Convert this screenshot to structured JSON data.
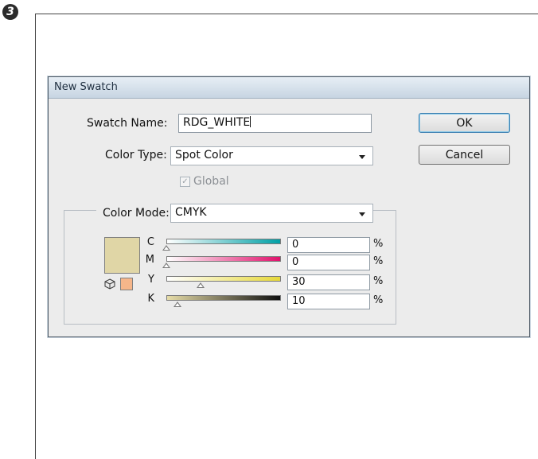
{
  "step_badge": "3",
  "dialog": {
    "title": "New Swatch",
    "swatch_name_label": "Swatch Name:",
    "swatch_name_value": "RDG_WHITE",
    "color_type_label": "Color Type:",
    "color_type_value": "Spot Color",
    "global_label": "Global",
    "global_checked": true,
    "global_enabled": false,
    "color_mode_label": "Color Mode:",
    "color_mode_value": "CMYK",
    "ok_label": "OK",
    "cancel_label": "Cancel",
    "swatch_color": "#e0d6a6",
    "out_of_gamut_color": "#f6b68a",
    "percent_sign": "%",
    "channels": [
      {
        "label": "C",
        "value": "0",
        "gradient": [
          "#ffffff",
          "#00a0a6"
        ],
        "level": 0
      },
      {
        "label": "M",
        "value": "0",
        "gradient": [
          "#ffffff",
          "#e0126c"
        ],
        "level": 0
      },
      {
        "label": "Y",
        "value": "30",
        "gradient": [
          "#ffffff",
          "#e6d83a"
        ],
        "level": 0.3
      },
      {
        "label": "K",
        "value": "10",
        "gradient": [
          "#e6dca8",
          "#101010"
        ],
        "level": 0.1
      }
    ]
  }
}
